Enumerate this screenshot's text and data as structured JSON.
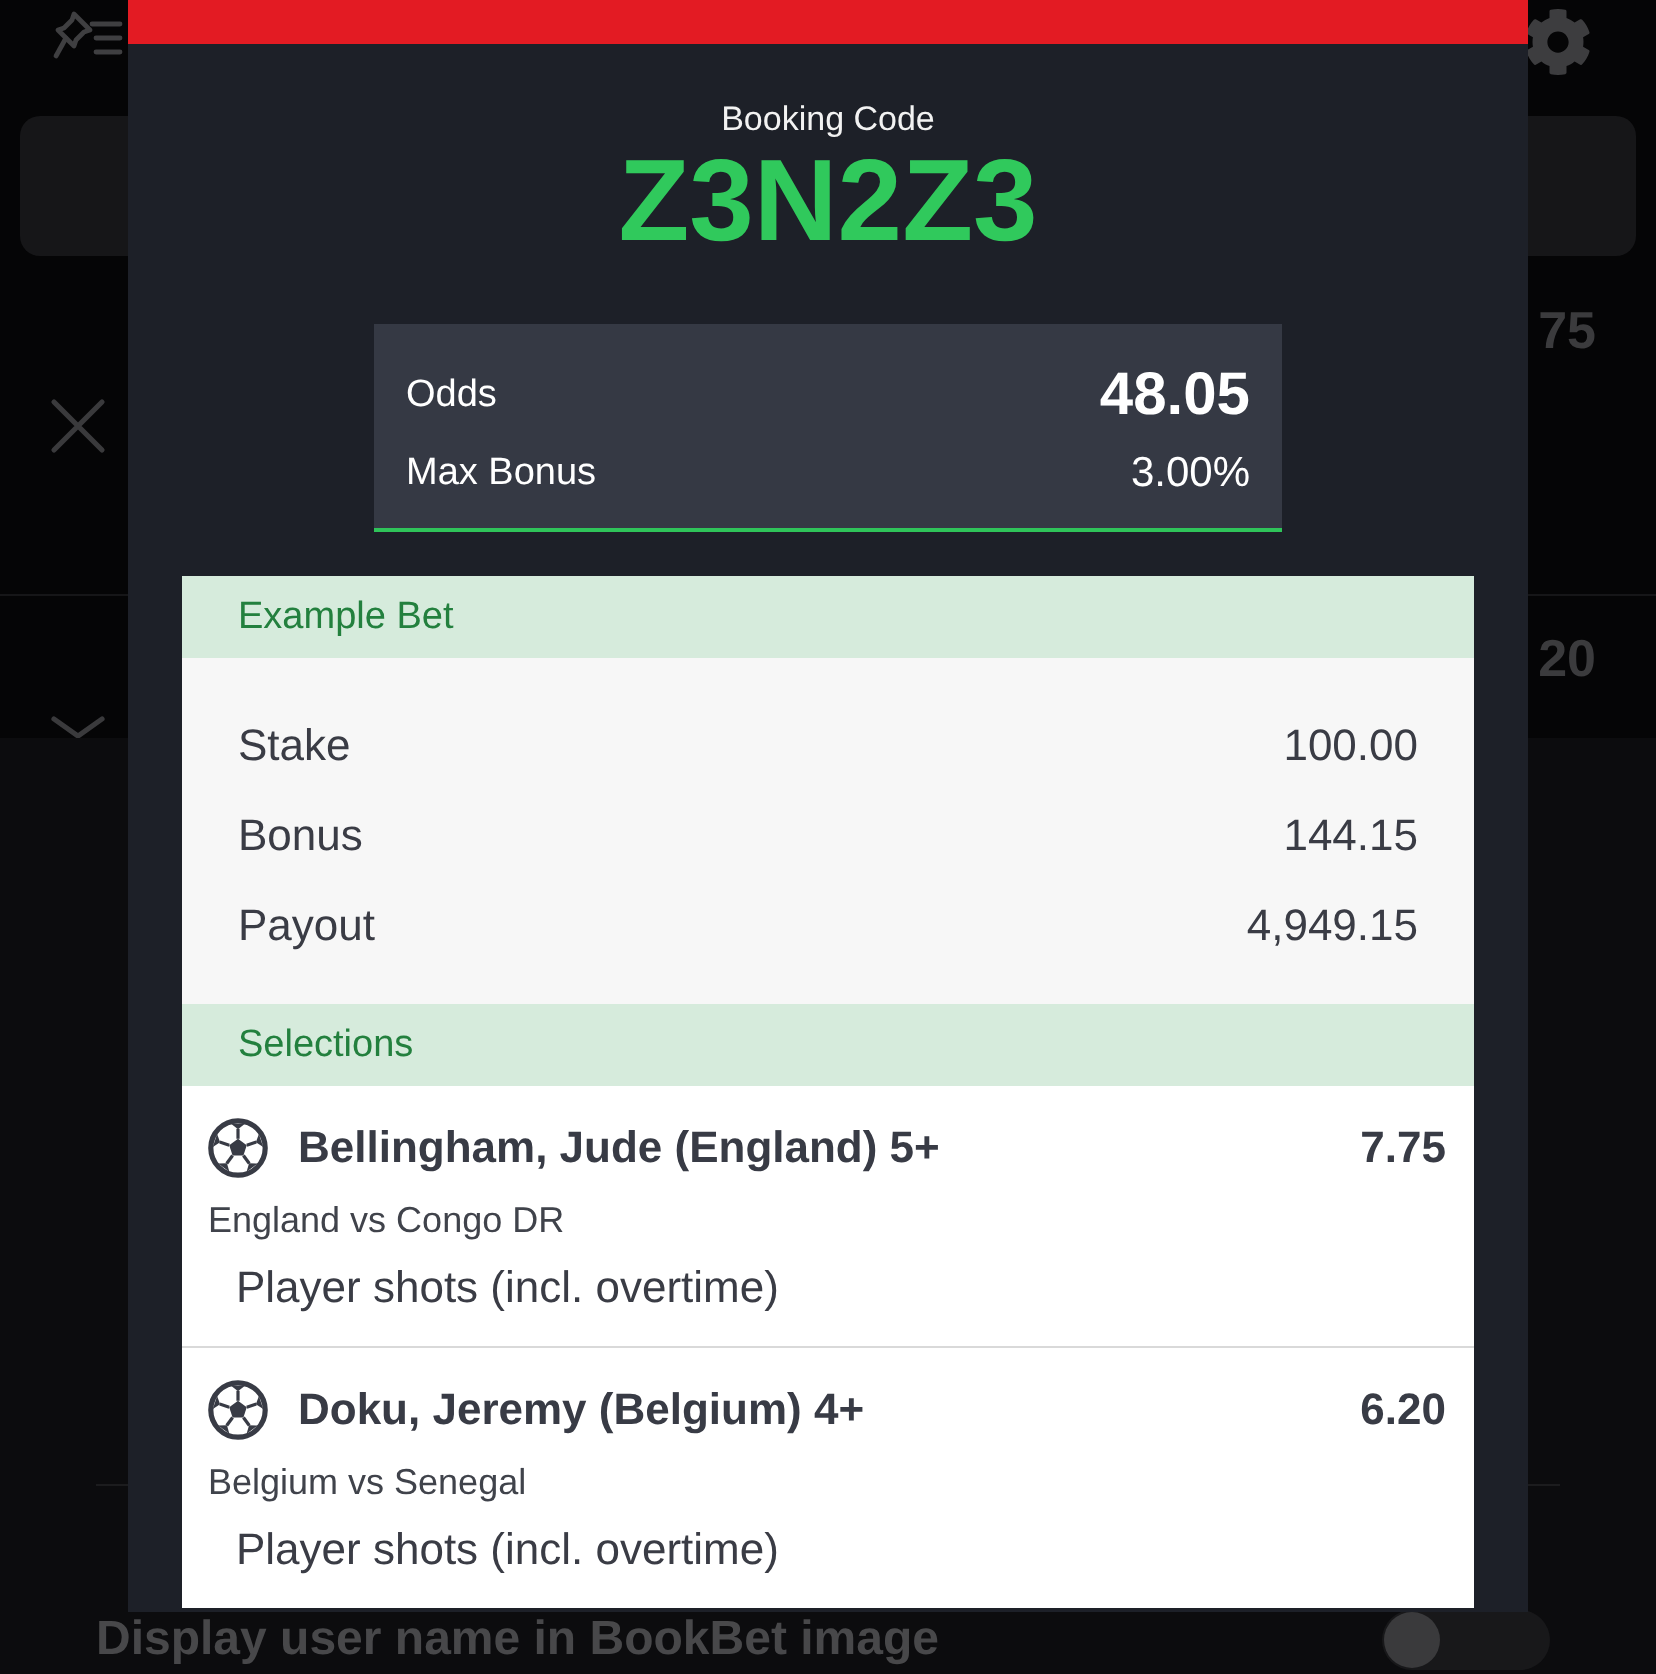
{
  "background": {
    "rows": [
      {
        "value": "75"
      },
      {
        "value": "20"
      }
    ],
    "setting": {
      "label": "Display user name in BookBet image",
      "on": false
    }
  },
  "modal": {
    "booking_code_label": "Booking Code",
    "booking_code": "Z3N2Z3",
    "odds": {
      "label": "Odds",
      "value": "48.05"
    },
    "max_bonus": {
      "label": "Max Bonus",
      "value": "3.00%"
    },
    "example_bet": {
      "title": "Example Bet",
      "rows": [
        {
          "label": "Stake",
          "value": "100.00"
        },
        {
          "label": "Bonus",
          "value": "144.15"
        },
        {
          "label": "Payout",
          "value": "4,949.15"
        }
      ]
    },
    "selections": {
      "title": "Selections",
      "items": [
        {
          "name": "Bellingham, Jude (England) 5+",
          "odds": "7.75",
          "match": "England vs Congo DR",
          "market": "Player shots (incl. overtime)"
        },
        {
          "name": "Doku, Jeremy (Belgium) 4+",
          "odds": "6.20",
          "match": "Belgium vs Senegal",
          "market": "Player shots (incl. overtime)"
        }
      ]
    }
  }
}
